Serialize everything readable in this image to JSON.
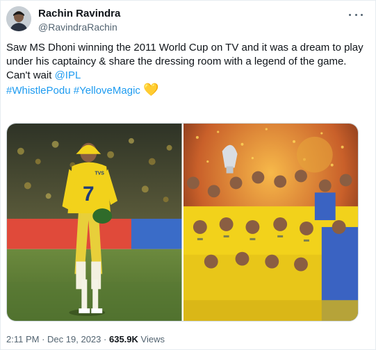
{
  "author": {
    "display_name": "Rachin Ravindra",
    "handle": "@RavindraRachin"
  },
  "tweet": {
    "line1": "Saw MS Dhoni winning the 2011 World Cup on TV and it was a dream to play under his captaincy & share the dressing room with a legend of the game.",
    "line2_prefix": "Can't wait ",
    "mention": "@IPL",
    "hashtag1": "#WhistlePodu",
    "hashtag2": "#YelloveMagic",
    "emoji": "💛"
  },
  "media": {
    "left_photo": {
      "shirt_number": "7",
      "sponsor": "TVS"
    },
    "right_photo": {}
  },
  "meta": {
    "time": "2:11 PM",
    "separator": "·",
    "date": "Dec 19, 2023",
    "views_count": "635.9K",
    "views_label": "Views"
  },
  "icons": {
    "more": "more-horizontal-icon",
    "heart": "yellow-heart-emoji"
  },
  "colors": {
    "link": "#1d9bf0",
    "text": "#0f1419",
    "muted": "#536471",
    "csk_yellow": "#f2d21b"
  }
}
